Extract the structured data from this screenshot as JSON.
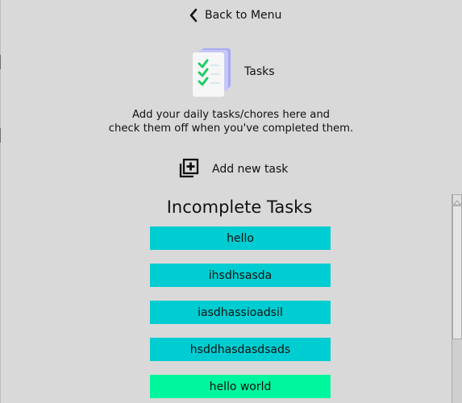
{
  "navigation": {
    "back_label": "Back to Menu",
    "back_icon": "chevron-left-icon"
  },
  "header": {
    "title": "Tasks",
    "icon": "task-checklist-icon"
  },
  "description": {
    "line1": "Add your daily tasks/chores here and",
    "line2": "check them off when you've completed them."
  },
  "actions": {
    "add_task_label": "Add new task",
    "add_task_icon": "add-square-icon"
  },
  "incomplete_tasks": {
    "title": "Incomplete Tasks",
    "items": [
      {
        "label": "hello",
        "color": "#00cdd1"
      },
      {
        "label": "ihsdhsasda",
        "color": "#00cdd1"
      },
      {
        "label": "iasdhassioadsil",
        "color": "#00cdd1"
      },
      {
        "label": "hsddhasdasdsads",
        "color": "#00cdd1"
      },
      {
        "label": "hello world",
        "color": "#00f69c"
      }
    ]
  },
  "colors": {
    "background": "#d9d9d9",
    "task_primary": "#00cdd1",
    "task_highlight": "#00f69c",
    "text": "#111111"
  }
}
